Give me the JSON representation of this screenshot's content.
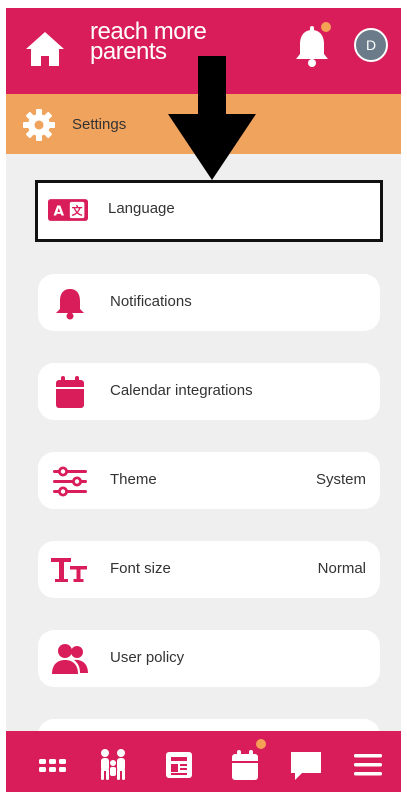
{
  "brand": {
    "name_line1": "reach more",
    "name_line2": "parents"
  },
  "header": {
    "avatar_initial": "D",
    "notification_badge": true
  },
  "page": {
    "title": "Settings"
  },
  "settings": {
    "items": [
      {
        "label": "Language",
        "value": "",
        "icon": "language-icon"
      },
      {
        "label": "Notifications",
        "value": "",
        "icon": "bell-icon"
      },
      {
        "label": "Calendar integrations",
        "value": "",
        "icon": "calendar-icon"
      },
      {
        "label": "Theme",
        "value": "System",
        "icon": "sliders-icon"
      },
      {
        "label": "Font size",
        "value": "Normal",
        "icon": "font-size-icon"
      },
      {
        "label": "User policy",
        "value": "",
        "icon": "users-icon"
      }
    ]
  },
  "bottom_nav": {
    "items": [
      "grid-icon",
      "family-icon",
      "newspaper-icon",
      "calendar-icon",
      "chat-icon",
      "menu-icon"
    ]
  },
  "colors": {
    "primary": "#d81d5a",
    "accent": "#f0a35d",
    "background": "#efefef",
    "avatar": "#6b7b8a"
  }
}
